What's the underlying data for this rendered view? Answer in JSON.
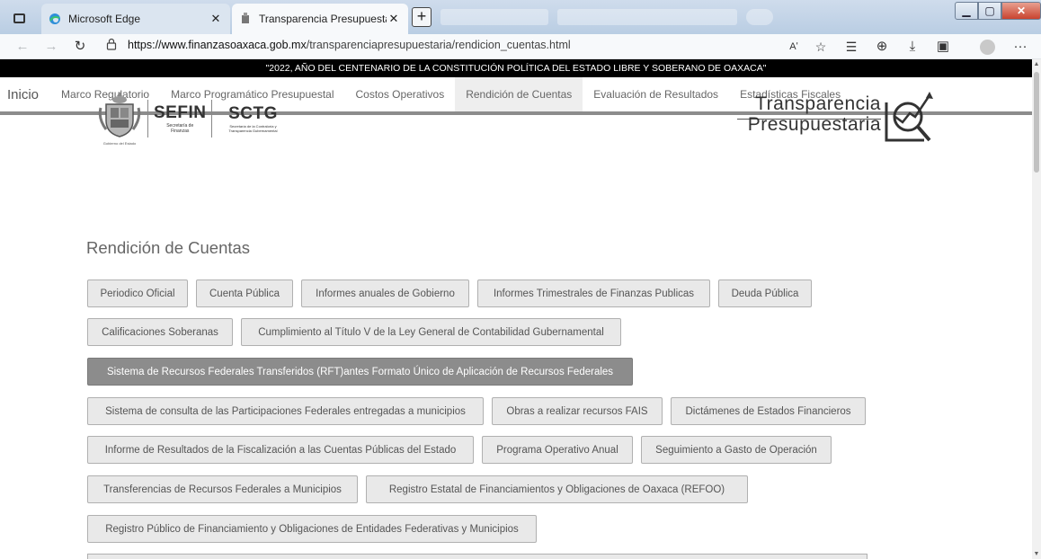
{
  "browser": {
    "tabs": [
      {
        "label": "Microsoft Edge",
        "close": "✕"
      },
      {
        "label": "Transparencia Presupuestaria - R",
        "close": "✕"
      }
    ],
    "new_tab": "+",
    "url_host": "https://www.finanzasoaxaca.gob.mx",
    "url_path": "/transparenciapresupuestaria/rendicion_cuentas.html",
    "read_aloud": "Aʹ",
    "more": "···"
  },
  "banner": "\"2022, AÑO DEL CENTENARIO DE LA CONSTITUCIÓN POLÍTICA DEL ESTADO LIBRE Y SOBERANO DE OAXACA\"",
  "nav": {
    "home": "Inicio",
    "items": [
      "Marco Regulatorio",
      "Marco Programático Presupuestal",
      "Costos Operativos",
      "Rendición de Cuentas",
      "Evaluación de Resultados",
      "Estadísticas Fiscales"
    ]
  },
  "logos": {
    "sefin": "SEFIN",
    "sefin_sub1": "Secretaría de",
    "sefin_sub2": "Finanzas",
    "sctg": "SCTG",
    "sctg_sub": "Secretaría de la Contraloría y Transparencia Gubernamental",
    "gobierno": "Gobierno del Estado",
    "transparencia": "Transparencia",
    "presupuestaria": "Presupuestaria"
  },
  "section_title": "Rendición de Cuentas",
  "buttons": [
    "Periodico Oficial",
    "Cuenta Pública",
    "Informes anuales de Gobierno",
    "Informes Trimestrales de Finanzas Publicas",
    "Deuda Pública",
    "Calificaciones Soberanas",
    "Cumplimiento al Título V de la Ley General de Contabilidad Gubernamental",
    "Sistema de Recursos Federales Transferidos (RFT)antes Formato Único de Aplicación de Recursos Federales",
    "Sistema de consulta de las Participaciones Federales entregadas a municipios",
    "Obras a realizar recursos FAIS",
    "Dictámenes de Estados Financieros",
    "Informe de Resultados de la Fiscalización a las Cuentas Públicas del Estado",
    "Programa Operativo Anual",
    "Seguimiento a Gasto de Operación",
    "Transferencias de Recursos Federales a Municipios",
    "Registro Estatal de Financiamientos y Obligaciones de Oaxaca (REFOO)",
    "Registro Público de Financiamiento y Obligaciones de Entidades Federativas y Municipios"
  ],
  "selected_button": "Sistema de Recursos Federales Transferidos (RFT)antes Formato Único de Aplicación de Recursos Federales"
}
